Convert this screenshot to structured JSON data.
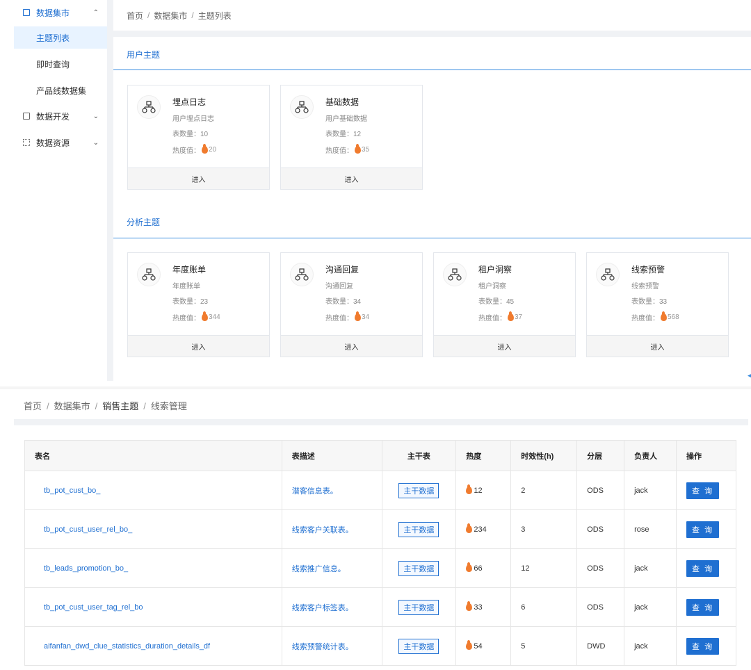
{
  "sidebar": {
    "groups": [
      {
        "label": "数据集市",
        "expanded": true,
        "icon": "table-icon"
      },
      {
        "label": "数据开发",
        "expanded": false,
        "icon": "code-icon"
      },
      {
        "label": "数据资源",
        "expanded": false,
        "icon": "grid-icon"
      }
    ],
    "subitems": [
      {
        "label": "主题列表",
        "active": true
      },
      {
        "label": "即时查询",
        "active": false
      },
      {
        "label": "产品线数据集",
        "active": false
      }
    ]
  },
  "top_breadcrumb": [
    "首页",
    "数据集市",
    "主题列表"
  ],
  "sections": [
    {
      "title": "用户主题",
      "cards": [
        {
          "title": "埋点日志",
          "desc": "用户埋点日志",
          "count_label": "表数量：",
          "count": "10",
          "heat_label": "热度值：",
          "heat": "20",
          "action": "进入"
        },
        {
          "title": "基础数据",
          "desc": "用户基础数据",
          "count_label": "表数量：",
          "count": "12",
          "heat_label": "热度值：",
          "heat": "35",
          "action": "进入"
        }
      ]
    },
    {
      "title": "分析主题",
      "cards": [
        {
          "title": "年度账单",
          "desc": "年度账单",
          "count_label": "表数量：",
          "count": "23",
          "heat_label": "热度值：",
          "heat": "344",
          "action": "进入"
        },
        {
          "title": "沟通回复",
          "desc": "沟通回复",
          "count_label": "表数量：",
          "count": "34",
          "heat_label": "热度值：",
          "heat": "34",
          "action": "进入"
        },
        {
          "title": "租户洞察",
          "desc": "租户洞察",
          "count_label": "表数量：",
          "count": "45",
          "heat_label": "热度值：",
          "heat": "37",
          "action": "进入"
        },
        {
          "title": "线索预警",
          "desc": "线索预警",
          "count_label": "表数量：",
          "count": "33",
          "heat_label": "热度值：",
          "heat": "568",
          "action": "进入"
        }
      ]
    }
  ],
  "bottom_breadcrumb": [
    "首页",
    "数据集市",
    "销售主题",
    "线索管理"
  ],
  "table": {
    "columns": [
      "表名",
      "表描述",
      "主干表",
      "热度",
      "时效性(h)",
      "分层",
      "负责人",
      "操作"
    ],
    "rows": [
      {
        "name": "tb_pot_cust_bo_",
        "desc": "潜客信息表。",
        "backbone": "主干数据",
        "heat": "12",
        "timeliness": "2",
        "layer": "ODS",
        "owner": "jack",
        "action": "查 询"
      },
      {
        "name": "tb_pot_cust_user_rel_bo_",
        "desc": "线索客户关联表。",
        "backbone": "主干数据",
        "heat": "234",
        "timeliness": "3",
        "layer": "ODS",
        "owner": "rose",
        "action": "查 询"
      },
      {
        "name": "tb_leads_promotion_bo_",
        "desc": "线索推广信息。",
        "backbone": "主干数据",
        "heat": "66",
        "timeliness": "12",
        "layer": "ODS",
        "owner": "jack",
        "action": "查 询"
      },
      {
        "name": "tb_pot_cust_user_tag_rel_bo",
        "desc": "线索客户标签表。",
        "backbone": "主干数据",
        "heat": "33",
        "timeliness": "6",
        "layer": "ODS",
        "owner": "jack",
        "action": "查 询"
      },
      {
        "name": "aifanfan_dwd_clue_statistics_duration_details_df",
        "desc": "线索预警统计表。",
        "backbone": "主干数据",
        "heat": "54",
        "timeliness": "5",
        "layer": "DWD",
        "owner": "jack",
        "action": "查 询"
      }
    ]
  },
  "colors": {
    "accent": "#1f6fd1",
    "flame": "#f07b2e",
    "section_line": "#3c8ee0"
  }
}
